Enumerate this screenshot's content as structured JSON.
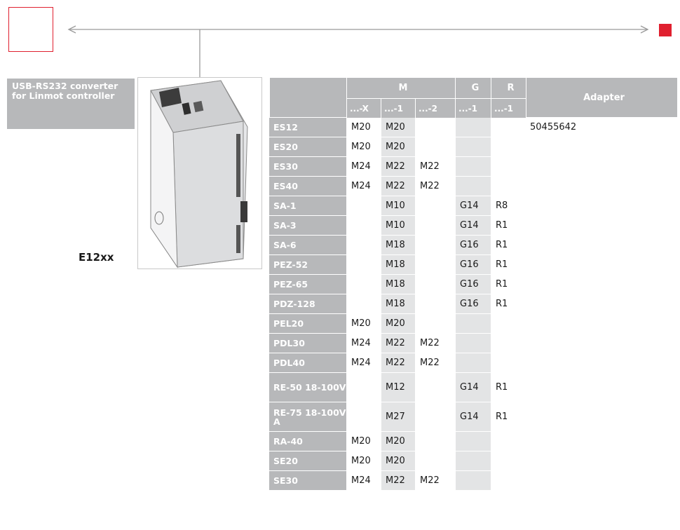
{
  "product": {
    "label": "USB-RS232 converter for Linmot controller",
    "model": "E12xx"
  },
  "table": {
    "group_headers": [
      "M",
      "G",
      "R",
      "Adapter"
    ],
    "sub_headers": [
      "...-X",
      "...-1",
      "...-2",
      "...-1",
      "...-1"
    ],
    "rows": [
      {
        "name": "ES12",
        "cells": [
          "M20",
          "M20",
          "",
          "",
          "",
          "50455642"
        ]
      },
      {
        "name": "ES20",
        "cells": [
          "M20",
          "M20",
          "",
          "",
          "",
          ""
        ]
      },
      {
        "name": "ES30",
        "cells": [
          "M24",
          "M22",
          "M22",
          "",
          "",
          ""
        ]
      },
      {
        "name": "ES40",
        "cells": [
          "M24",
          "M22",
          "M22",
          "",
          "",
          ""
        ]
      },
      {
        "name": "SA-1",
        "cells": [
          "",
          "M10",
          "",
          "G14",
          "R8",
          ""
        ]
      },
      {
        "name": "SA-3",
        "cells": [
          "",
          "M10",
          "",
          "G14",
          "R1",
          ""
        ]
      },
      {
        "name": "SA-6",
        "cells": [
          "",
          "M18",
          "",
          "G16",
          "R1",
          ""
        ]
      },
      {
        "name": "PEZ-52",
        "cells": [
          "",
          "M18",
          "",
          "G16",
          "R1",
          ""
        ]
      },
      {
        "name": "PEZ-65",
        "cells": [
          "",
          "M18",
          "",
          "G16",
          "R1",
          ""
        ]
      },
      {
        "name": "PDZ-128",
        "cells": [
          "",
          "M18",
          "",
          "G16",
          "R1",
          ""
        ]
      },
      {
        "name": "PEL20",
        "cells": [
          "M20",
          "M20",
          "",
          "",
          "",
          ""
        ]
      },
      {
        "name": "PDL30",
        "cells": [
          "M24",
          "M22",
          "M22",
          "",
          "",
          ""
        ]
      },
      {
        "name": "PDL40",
        "cells": [
          "M24",
          "M22",
          "M22",
          "",
          "",
          ""
        ]
      },
      {
        "name": "RE-50 18-100V",
        "cells": [
          "",
          "M12",
          "",
          "G14",
          "R1",
          ""
        ],
        "tall": true
      },
      {
        "name": "RE-75 18-100V A",
        "cells": [
          "",
          "M27",
          "",
          "G14",
          "R1",
          ""
        ],
        "tall": true
      },
      {
        "name": "RA-40",
        "cells": [
          "M20",
          "M20",
          "",
          "",
          "",
          ""
        ]
      },
      {
        "name": "SE20",
        "cells": [
          "M20",
          "M20",
          "",
          "",
          "",
          ""
        ]
      },
      {
        "name": "SE30",
        "cells": [
          "M24",
          "M22",
          "M22",
          "",
          "",
          ""
        ]
      }
    ]
  },
  "colors": {
    "accent_red": "#e0202f",
    "header_gray": "#b7b8ba",
    "column_shade": "#e3e4e5"
  },
  "icons": [
    "arrow-left-icon",
    "arrow-right-icon"
  ]
}
